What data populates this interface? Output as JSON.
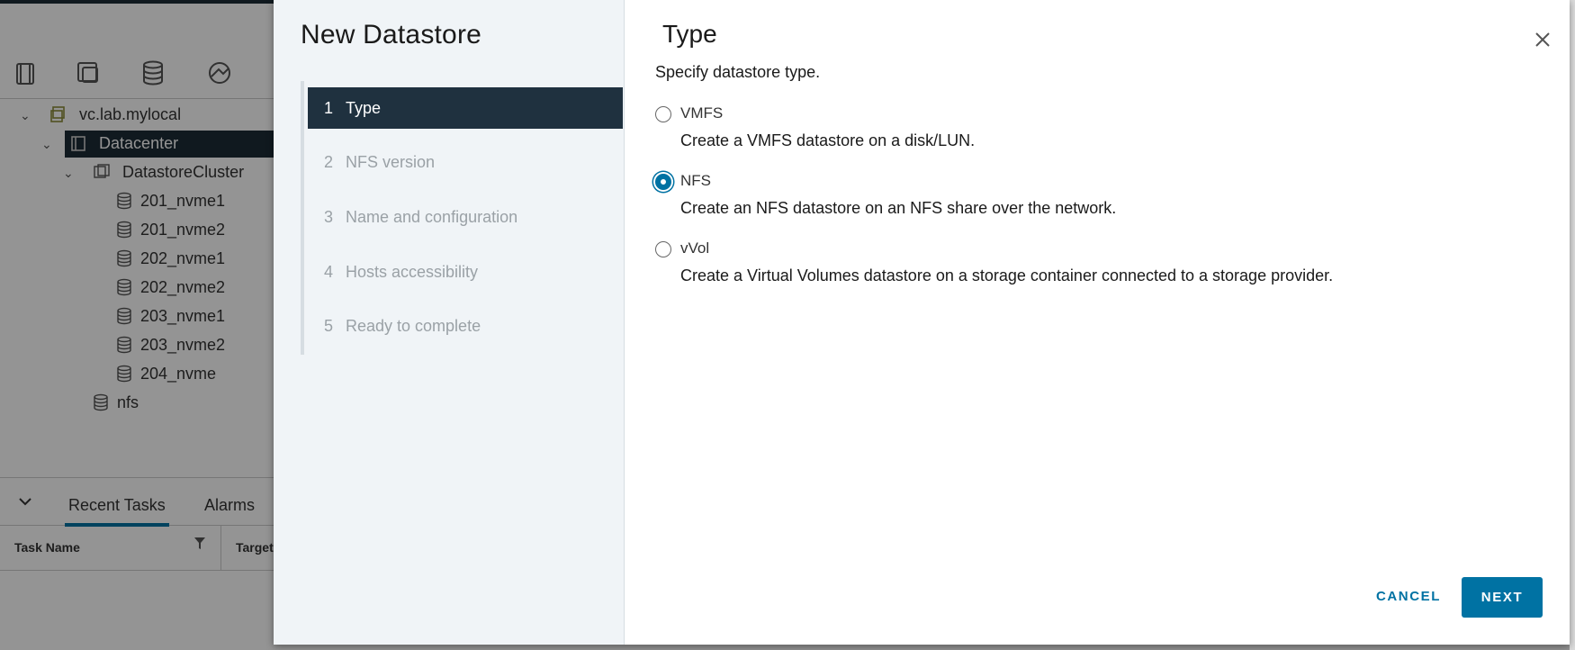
{
  "background": {
    "tree": {
      "root": "vc.lab.mylocal",
      "datacenter": "Datacenter",
      "cluster": "DatastoreCluster",
      "datastores": [
        "201_nvme1",
        "201_nvme2",
        "202_nvme1",
        "202_nvme2",
        "203_nvme1",
        "203_nvme2",
        "204_nvme"
      ],
      "standalone": "nfs"
    },
    "tabs": {
      "recent_tasks": "Recent Tasks",
      "alarms": "Alarms"
    },
    "table": {
      "task_name": "Task Name",
      "target": "Target"
    }
  },
  "wizard": {
    "title": "New Datastore",
    "steps": [
      {
        "num": "1",
        "label": "Type"
      },
      {
        "num": "2",
        "label": "NFS version"
      },
      {
        "num": "3",
        "label": "Name and configuration"
      },
      {
        "num": "4",
        "label": "Hosts accessibility"
      },
      {
        "num": "5",
        "label": "Ready to complete"
      }
    ],
    "active_step": 1
  },
  "page": {
    "title": "Type",
    "subtitle": "Specify datastore type.",
    "options": [
      {
        "label": "VMFS",
        "desc": "Create a VMFS datastore on a disk/LUN.",
        "checked": false
      },
      {
        "label": "NFS",
        "desc": "Create an NFS datastore on an NFS share over the network.",
        "checked": true
      },
      {
        "label": "vVol",
        "desc": "Create a Virtual Volumes datastore on a storage container connected to a storage provider.",
        "checked": false
      }
    ]
  },
  "buttons": {
    "cancel": "CANCEL",
    "next": "NEXT"
  },
  "colors": {
    "accent": "#0072a3",
    "nav_active": "#1f313f",
    "nav_bg": "#f0f4f7"
  },
  "icons": {
    "close": "close-icon",
    "datastore": "datastore-icon",
    "filter": "filter-icon"
  }
}
